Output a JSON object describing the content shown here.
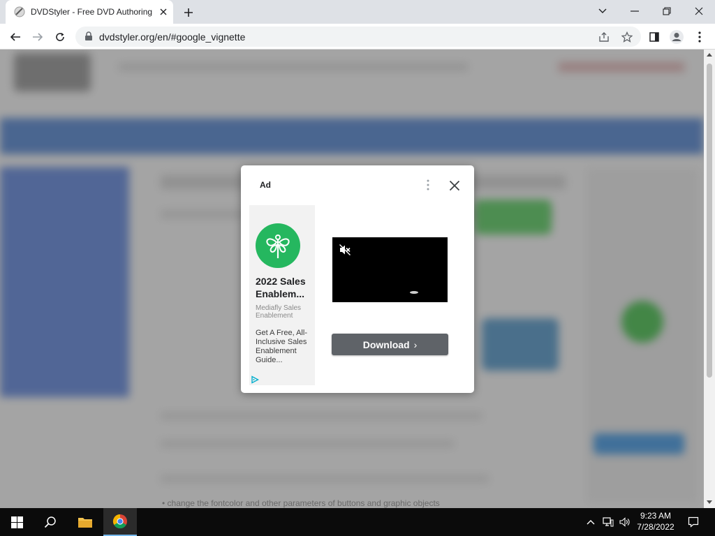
{
  "browser": {
    "tab_title": "DVDStyler - Free DVD Authoring",
    "url": "dvdstyler.org/en/#google_vignette"
  },
  "ad": {
    "label": "Ad",
    "headline": "2022 Sales Enablem...",
    "advertiser": "Mediafly Sales Enablement",
    "description": "Get A Free, All-Inclusive Sales Enablement Guide...",
    "cta": "Download",
    "brand_color": "#25b75f"
  },
  "background_page": {
    "visible_text": "change the fontcolor and other parameters of buttons and graphic objects"
  },
  "taskbar": {
    "time": "9:23 AM",
    "date": "7/28/2022"
  },
  "icons": [
    "chrome-favicon",
    "close-icon",
    "plus-icon",
    "chevron-down-icon",
    "minimize-icon",
    "restore-icon",
    "back-icon",
    "forward-icon",
    "reload-icon",
    "lock-icon",
    "share-icon",
    "star-icon",
    "sidepanel-icon",
    "profile-icon",
    "more-vert-icon",
    "mute-icon",
    "adchoices-icon",
    "windows-start-icon",
    "search-icon",
    "file-explorer-icon",
    "chrome-icon",
    "tray-chevron-icon",
    "network-icon",
    "volume-icon",
    "notification-icon"
  ]
}
